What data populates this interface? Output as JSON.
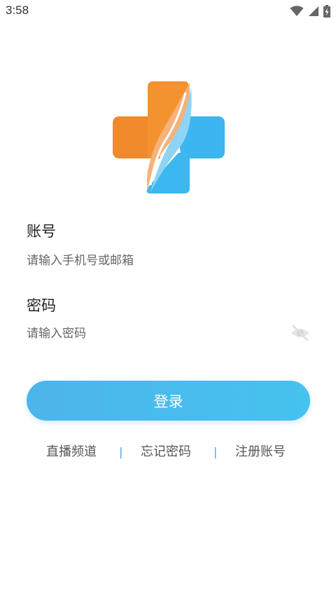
{
  "status_bar": {
    "time": "3:58",
    "icons": [
      "wifi-icon",
      "cell-signal-icon",
      "battery-charging-icon"
    ]
  },
  "logo": {
    "name": "medical-cross-logo",
    "colors": {
      "orange": "#F18A2C",
      "blue": "#3DB5EE"
    }
  },
  "account": {
    "label": "账号",
    "placeholder": "请输入手机号或邮箱",
    "value": ""
  },
  "password": {
    "label": "密码",
    "placeholder": "请输入密码",
    "value": "",
    "toggle_icon": "eye-off-icon"
  },
  "login_button": {
    "label": "登录",
    "color": "#46BDEE"
  },
  "links": {
    "live": "直播频道",
    "forgot_password": "忘记密码",
    "register": "注册账号",
    "separator": "|"
  }
}
